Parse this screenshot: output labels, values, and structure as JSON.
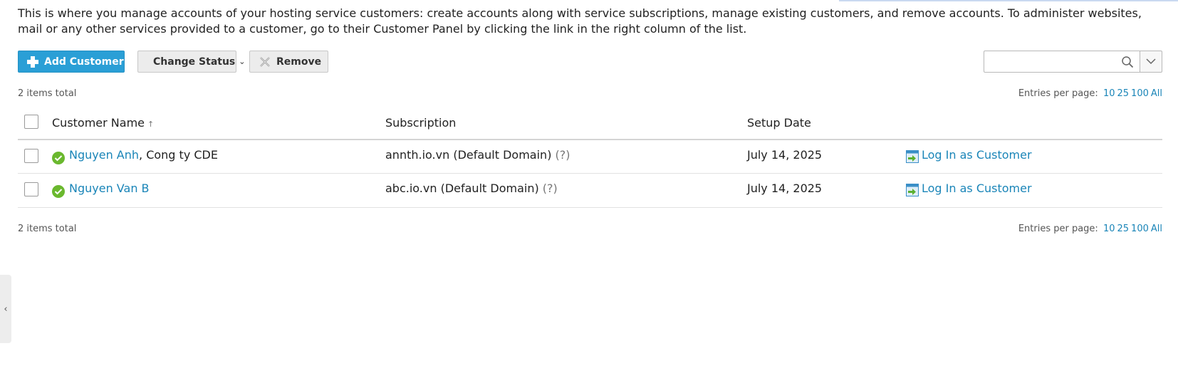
{
  "intro_text": "This is where you manage accounts of your hosting service customers: create accounts along with service subscriptions, manage existing customers, and remove accounts. To administer websites, mail or any other services provided to a customer, go to their Customer Panel by clicking the link in the right column of the list.",
  "toolbar": {
    "add_label": "Add Customer",
    "change_status_label": "Change Status",
    "remove_label": "Remove"
  },
  "search": {
    "value": "",
    "placeholder": ""
  },
  "list_info": {
    "items_total": "2 items total",
    "entries_label": "Entries per page:",
    "entries_options": [
      "10",
      "25",
      "100",
      "All"
    ]
  },
  "table": {
    "columns": {
      "name": "Customer Name",
      "sort_icon": "↑",
      "subscription": "Subscription",
      "setup_date": "Setup Date"
    },
    "rows": [
      {
        "name_link": "Nguyen Anh",
        "company": ", Cong ty CDE",
        "subscription": "annth.io.vn (Default Domain)",
        "hint": "(?)",
        "setup_date": "July 14, 2025",
        "login_label": "Log In as Customer"
      },
      {
        "name_link": "Nguyen Van B",
        "company": "",
        "subscription": "abc.io.vn (Default Domain)",
        "hint": "(?)",
        "setup_date": "July 14, 2025",
        "login_label": "Log In as Customer"
      }
    ]
  },
  "side_toggle_glyph": "‹",
  "colors": {
    "primary": "#2a9fd6",
    "link": "#1a85b8",
    "status_ok": "#6ab82e"
  }
}
